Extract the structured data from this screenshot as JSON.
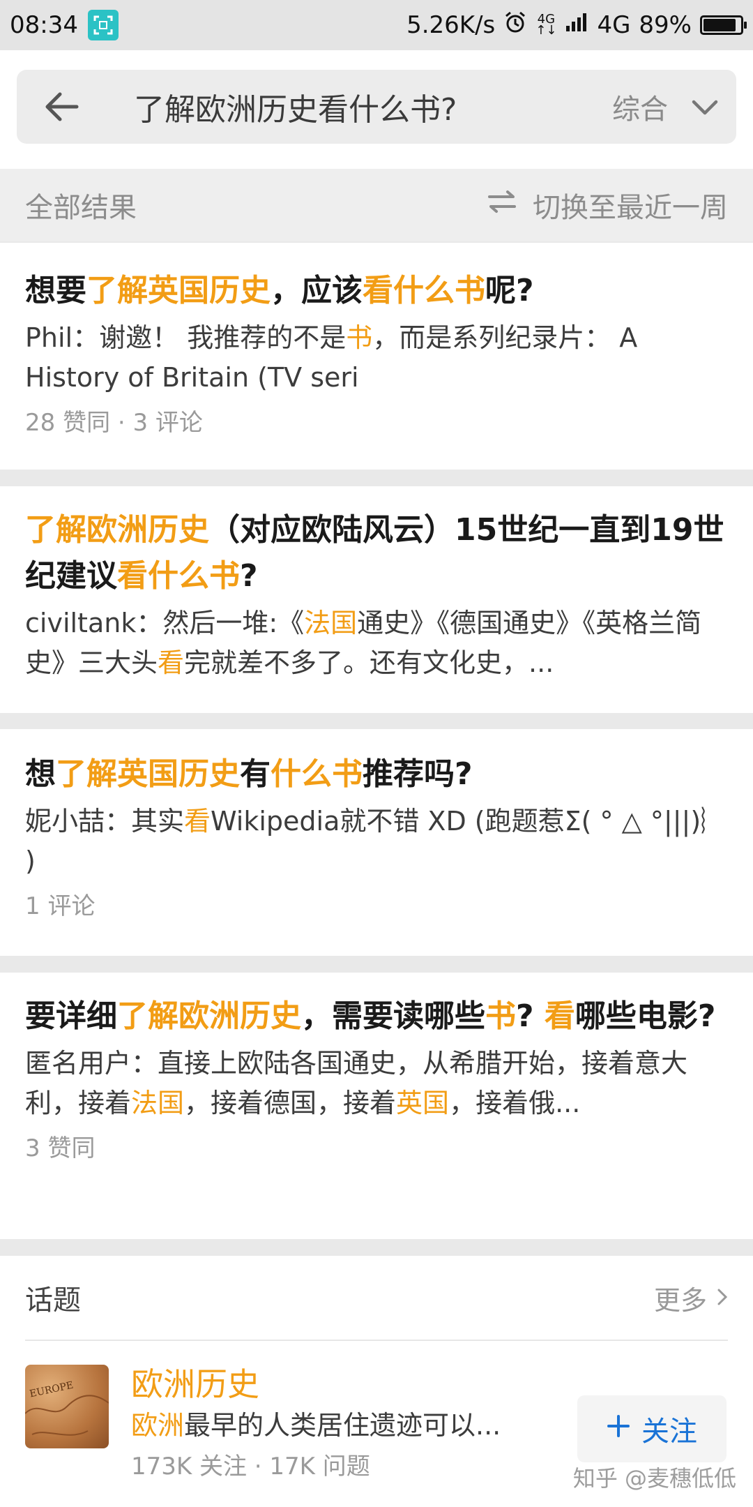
{
  "status_bar": {
    "time": "08:34",
    "network_speed": "5.26K/s",
    "signal_small_top": "4G",
    "signal_small_bottom": "↑↓",
    "network_type": "4G",
    "battery_percent": "89%",
    "battery_level": 0.89
  },
  "search": {
    "back_icon": "arrow-left-icon",
    "query": "了解欧洲历史看什么书?",
    "sort_label": "综合",
    "sort_icon": "chevron-down-icon"
  },
  "results_bar": {
    "all_results": "全部结果",
    "switch_icon": "swap-arrows-icon",
    "switch_label": "切换至最近一周"
  },
  "results": [
    {
      "title": [
        {
          "t": "想要",
          "hl": false
        },
        {
          "t": "了解英国历史",
          "hl": true
        },
        {
          "t": "，应该",
          "hl": false
        },
        {
          "t": "看什么书",
          "hl": true
        },
        {
          "t": "呢?",
          "hl": false
        }
      ],
      "snippet": [
        {
          "t": "Phil：谢邀！ 我推荐的不是",
          "hl": false
        },
        {
          "t": "书",
          "hl": true
        },
        {
          "t": "，而是系列纪录片： A History of Britain (TV seri",
          "hl": false
        }
      ],
      "meta": "28 赞同 · 3 评论"
    },
    {
      "title": [
        {
          "t": "了解欧洲历史",
          "hl": true
        },
        {
          "t": "（对应欧陆风云）15世纪一直到19世纪建议",
          "hl": false
        },
        {
          "t": "看什么书",
          "hl": true
        },
        {
          "t": "?",
          "hl": false
        }
      ],
      "snippet": [
        {
          "t": "civiltank：然后一堆:《",
          "hl": false
        },
        {
          "t": "法国",
          "hl": true
        },
        {
          "t": "通史》《德国通史》《英格兰简史》三大头",
          "hl": false
        },
        {
          "t": "看",
          "hl": true
        },
        {
          "t": "完就差不多了。还有文化史，...",
          "hl": false
        }
      ],
      "meta": ""
    },
    {
      "title": [
        {
          "t": "想",
          "hl": false
        },
        {
          "t": "了解英国历史",
          "hl": true
        },
        {
          "t": "有",
          "hl": false
        },
        {
          "t": "什么书",
          "hl": true
        },
        {
          "t": "推荐吗?",
          "hl": false
        }
      ],
      "snippet": [
        {
          "t": "妮小喆：其实",
          "hl": false
        },
        {
          "t": "看",
          "hl": true
        },
        {
          "t": "Wikipedia就不错 XD (跑题惹Σ( ° △ °|||)︴ )",
          "hl": false
        }
      ],
      "meta": "1 评论"
    },
    {
      "title": [
        {
          "t": "要详细",
          "hl": false
        },
        {
          "t": "了解欧洲历史",
          "hl": true
        },
        {
          "t": "，需要读哪些",
          "hl": false
        },
        {
          "t": "书",
          "hl": true
        },
        {
          "t": "? ",
          "hl": false
        },
        {
          "t": "看",
          "hl": true
        },
        {
          "t": "哪些电影?",
          "hl": false
        }
      ],
      "snippet": [
        {
          "t": "匿名用户：直接上欧陆各国通史，从希腊开始，接着意大利，接着",
          "hl": false
        },
        {
          "t": "法国",
          "hl": true
        },
        {
          "t": "，接着德国，接着",
          "hl": false
        },
        {
          "t": "英国",
          "hl": true
        },
        {
          "t": "，接着俄...",
          "hl": false
        }
      ],
      "meta": "3 赞同"
    }
  ],
  "topics": {
    "section_title": "话题",
    "more_label": "更多",
    "more_icon": "chevron-right-icon",
    "item": {
      "thumb_text": "EUROPE",
      "name": "欧洲历史",
      "desc_hl": "欧洲",
      "desc_rest": "最早的人类居住遗迹可以...",
      "stats": "173K 关注 · 17K 问题",
      "follow_icon": "plus-icon",
      "follow_label": "关注"
    }
  },
  "watermark": "知乎 @麦穗低低",
  "colors": {
    "highlight": "#f29d15",
    "follow_blue": "#1a73d6"
  }
}
